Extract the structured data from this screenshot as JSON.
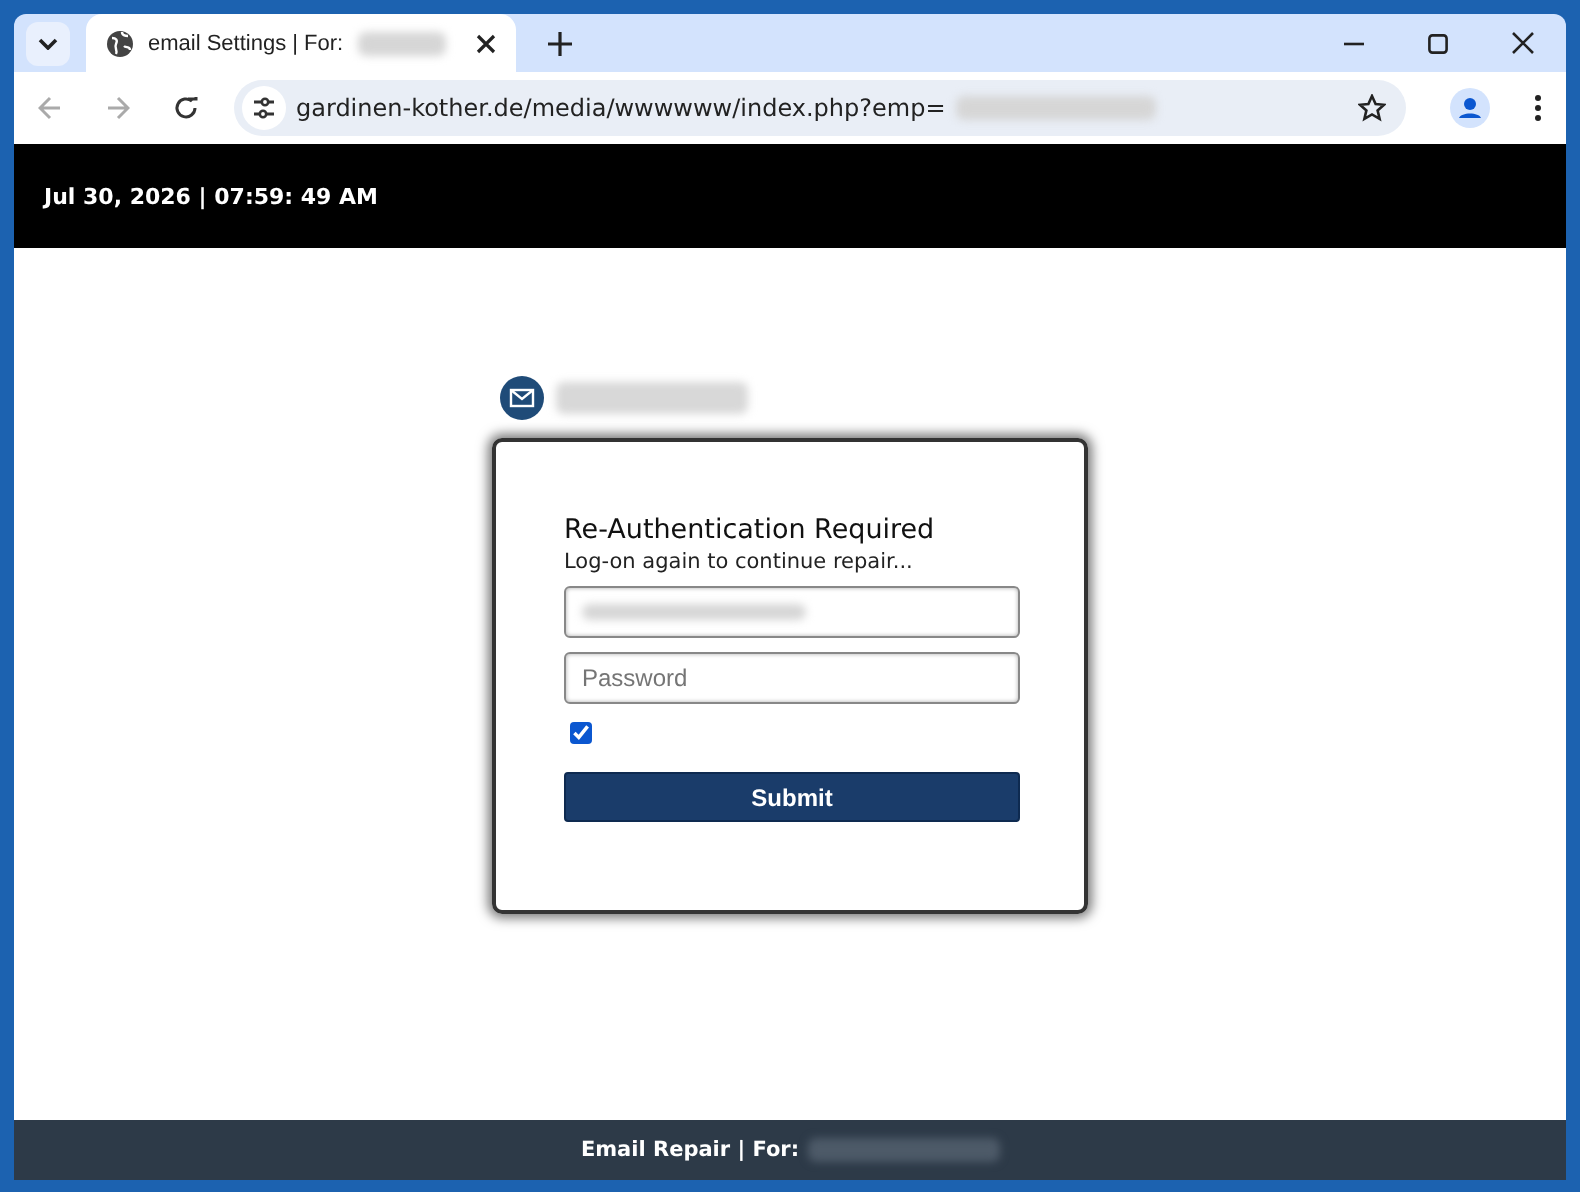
{
  "browser": {
    "tab": {
      "title": "email Settings | For:",
      "selected": true
    },
    "url": "gardinen-kother.de/media/wwwwww/index.php?emp="
  },
  "header": {
    "datetime": "Jul 30, 2026 | 07:59: 49 AM"
  },
  "form": {
    "title": "Re-Authentication Required",
    "subtitle": "Log-on again to continue repair...",
    "password": {
      "placeholder": "Password"
    },
    "remember": {
      "checked": true
    },
    "submit": "Submit"
  },
  "footer": {
    "text": "Email Repair | For:"
  }
}
